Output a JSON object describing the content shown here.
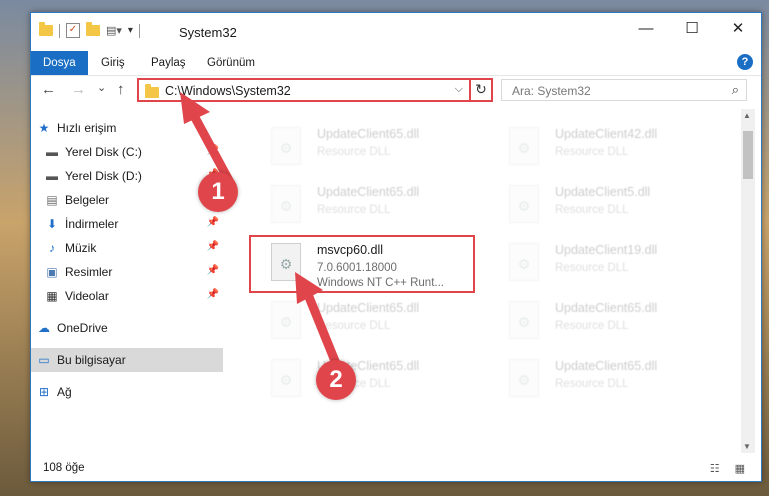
{
  "window": {
    "title": "System32",
    "controls": {
      "minimize": "—",
      "maximize": "☐",
      "close": "✕"
    }
  },
  "ribbon": {
    "tabs": [
      "Dosya",
      "Giriş",
      "Paylaş",
      "Görünüm"
    ],
    "active": "Dosya",
    "help": "?"
  },
  "nav": {
    "back": "←",
    "forward": "→",
    "recent": "⌄",
    "up": "↑",
    "address": "C:\\Windows\\System32",
    "dropdown": "⌵",
    "refresh": "↻",
    "search_placeholder": "Ara: System32",
    "search_icon": "⌕"
  },
  "sidebar": {
    "items": [
      {
        "label": "Hızlı erişim",
        "icon": "star-icon",
        "glyph": "★",
        "color": "#1f6fc9"
      },
      {
        "label": "Yerel Disk (C:)",
        "icon": "drive-icon",
        "glyph": "▬",
        "color": "#555555",
        "pin": "📌"
      },
      {
        "label": "Yerel Disk (D:)",
        "icon": "drive-icon",
        "glyph": "▬",
        "color": "#555555",
        "pin": "📌"
      },
      {
        "label": "Belgeler",
        "icon": "document-icon",
        "glyph": "▤",
        "color": "#6b6b6b",
        "pin": "📌"
      },
      {
        "label": "İndirmeler",
        "icon": "download-icon",
        "glyph": "⬇",
        "color": "#1f6fc9",
        "pin": "📌"
      },
      {
        "label": "Müzik",
        "icon": "music-icon",
        "glyph": "♪",
        "color": "#1f6fc9",
        "pin": "📌"
      },
      {
        "label": "Resimler",
        "icon": "pictures-icon",
        "glyph": "▣",
        "color": "#4a7ab0",
        "pin": "📌"
      },
      {
        "label": "Videolar",
        "icon": "video-icon",
        "glyph": "▦",
        "color": "#333333",
        "pin": "📌"
      },
      {
        "label": "OneDrive",
        "icon": "cloud-icon",
        "glyph": "☁",
        "color": "#1f6fc9"
      },
      {
        "label": "Bu bilgisayar",
        "icon": "computer-icon",
        "glyph": "▭",
        "color": "#1f6fc9"
      },
      {
        "label": "Ağ",
        "icon": "network-icon",
        "glyph": "⊞",
        "color": "#1f6fc9"
      }
    ]
  },
  "files": [
    {
      "name": "UpdateClient65.dll",
      "line1": "Resource DLL",
      "faded": true
    },
    {
      "name": "UpdateClient42.dll",
      "line1": "Resource DLL",
      "faded": true
    },
    {
      "name": "UpdateClient65.dll",
      "line1": "Resource DLL",
      "faded": true
    },
    {
      "name": "UpdateClient5.dll",
      "line1": "Resource DLL",
      "faded": true
    },
    {
      "name": "msvcp60.dll",
      "line1": "7.0.6001.18000",
      "line2": "Windows NT C++ Runt...",
      "faded": false
    },
    {
      "name": "UpdateClient19.dll",
      "line1": "Resource DLL",
      "faded": true
    },
    {
      "name": "UpdateClient65.dll",
      "line1": "Resource DLL",
      "faded": true
    },
    {
      "name": "UpdateClient65.dll",
      "line1": "Resource DLL",
      "faded": true
    },
    {
      "name": "UpdateClient65.dll",
      "line1": "Resource DLL",
      "faded": true
    },
    {
      "name": "UpdateClient65.dll",
      "line1": "Resource DLL",
      "faded": true
    }
  ],
  "status": {
    "count": "108 öğe",
    "views": "☷ ▦"
  },
  "annotations": {
    "badge1": "1",
    "badge2": "2",
    "color": "#e0454b"
  }
}
